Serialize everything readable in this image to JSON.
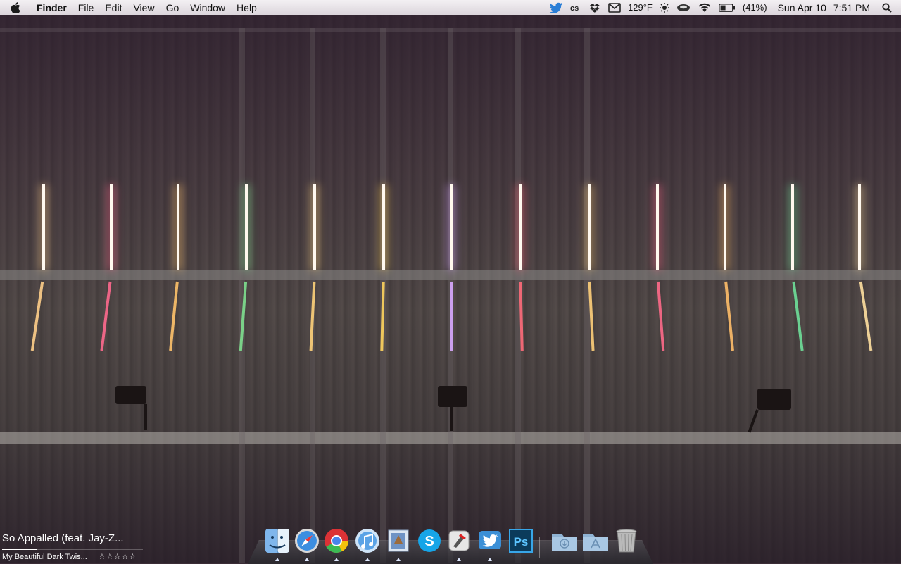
{
  "menubar": {
    "app_name": "Finder",
    "items": [
      "File",
      "Edit",
      "View",
      "Go",
      "Window",
      "Help"
    ],
    "temperature": "129°F",
    "battery": "(41%)",
    "date": "Sun Apr 10",
    "time": "7:51 PM",
    "status_icons": [
      "twitter-icon",
      "lastfm-icon",
      "dropbox-icon",
      "gmail-icon",
      "brightness-icon",
      "coffee-cup-icon",
      "wifi-icon",
      "battery-icon",
      "spotlight-icon"
    ]
  },
  "now_playing": {
    "track": "So Appalled (feat. Jay-Z...",
    "album": "My Beautiful Dark Twis...",
    "rating": "☆☆☆☆☆",
    "progress": 0.25
  },
  "dock": {
    "apps": [
      "finder",
      "safari",
      "chrome",
      "itunes",
      "mail",
      "skype",
      "sparrow",
      "twitter",
      "photoshop"
    ],
    "folders": [
      "downloads",
      "applications"
    ],
    "trash": "trash"
  },
  "colors": {
    "menubar_bg": "#e6e1e6",
    "wallpaper_dark": "#3a2c36"
  }
}
